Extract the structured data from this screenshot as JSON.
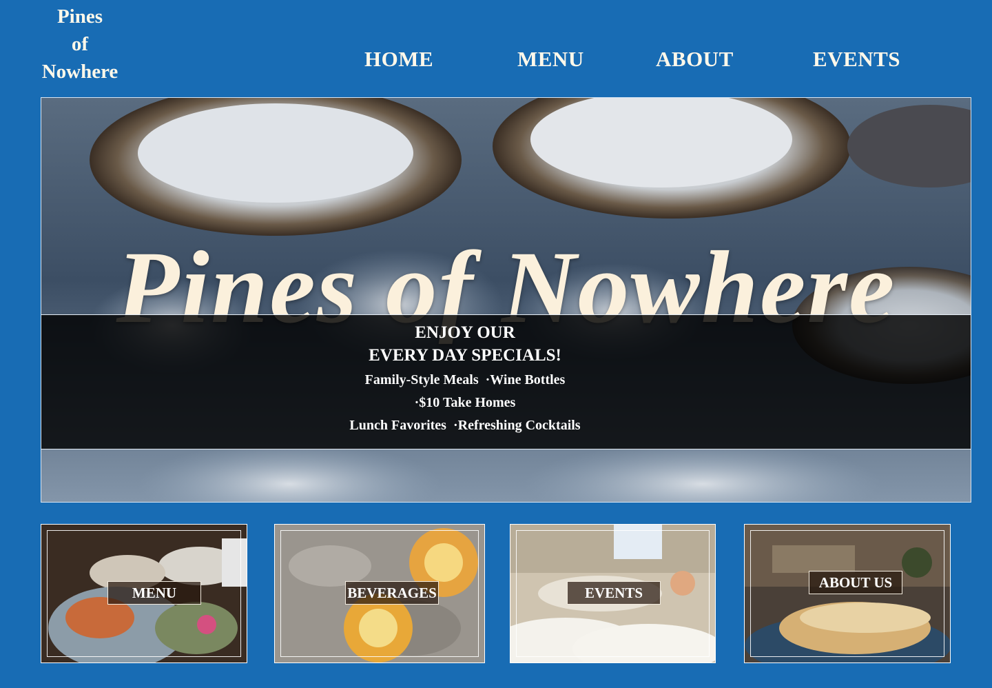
{
  "brand": {
    "logo_lines": [
      "Pines",
      "of",
      "Nowhere"
    ]
  },
  "nav": {
    "items": [
      "HOME",
      "MENU",
      "ABOUT",
      "EVENTS"
    ]
  },
  "hero": {
    "title": "Pines of Nowhere",
    "specials": {
      "heading_1": "ENJOY OUR",
      "heading_2": "EVERY DAY SPECIALS!",
      "line_1": "Family-Style Meals  ·Wine Bottles",
      "line_2": "·$10 Take Homes",
      "line_3": "Lunch Favorites  ·Refreshing Cocktails"
    }
  },
  "cards": [
    {
      "label": "MENU"
    },
    {
      "label": "BEVERAGES"
    },
    {
      "label": "EVENTS"
    },
    {
      "label": "ABOUT US"
    }
  ],
  "colors": {
    "page_background": "#186cb4",
    "logo_text": "#fff8ea",
    "hero_title": "#fbf0dc",
    "specials_band": "#000000"
  }
}
